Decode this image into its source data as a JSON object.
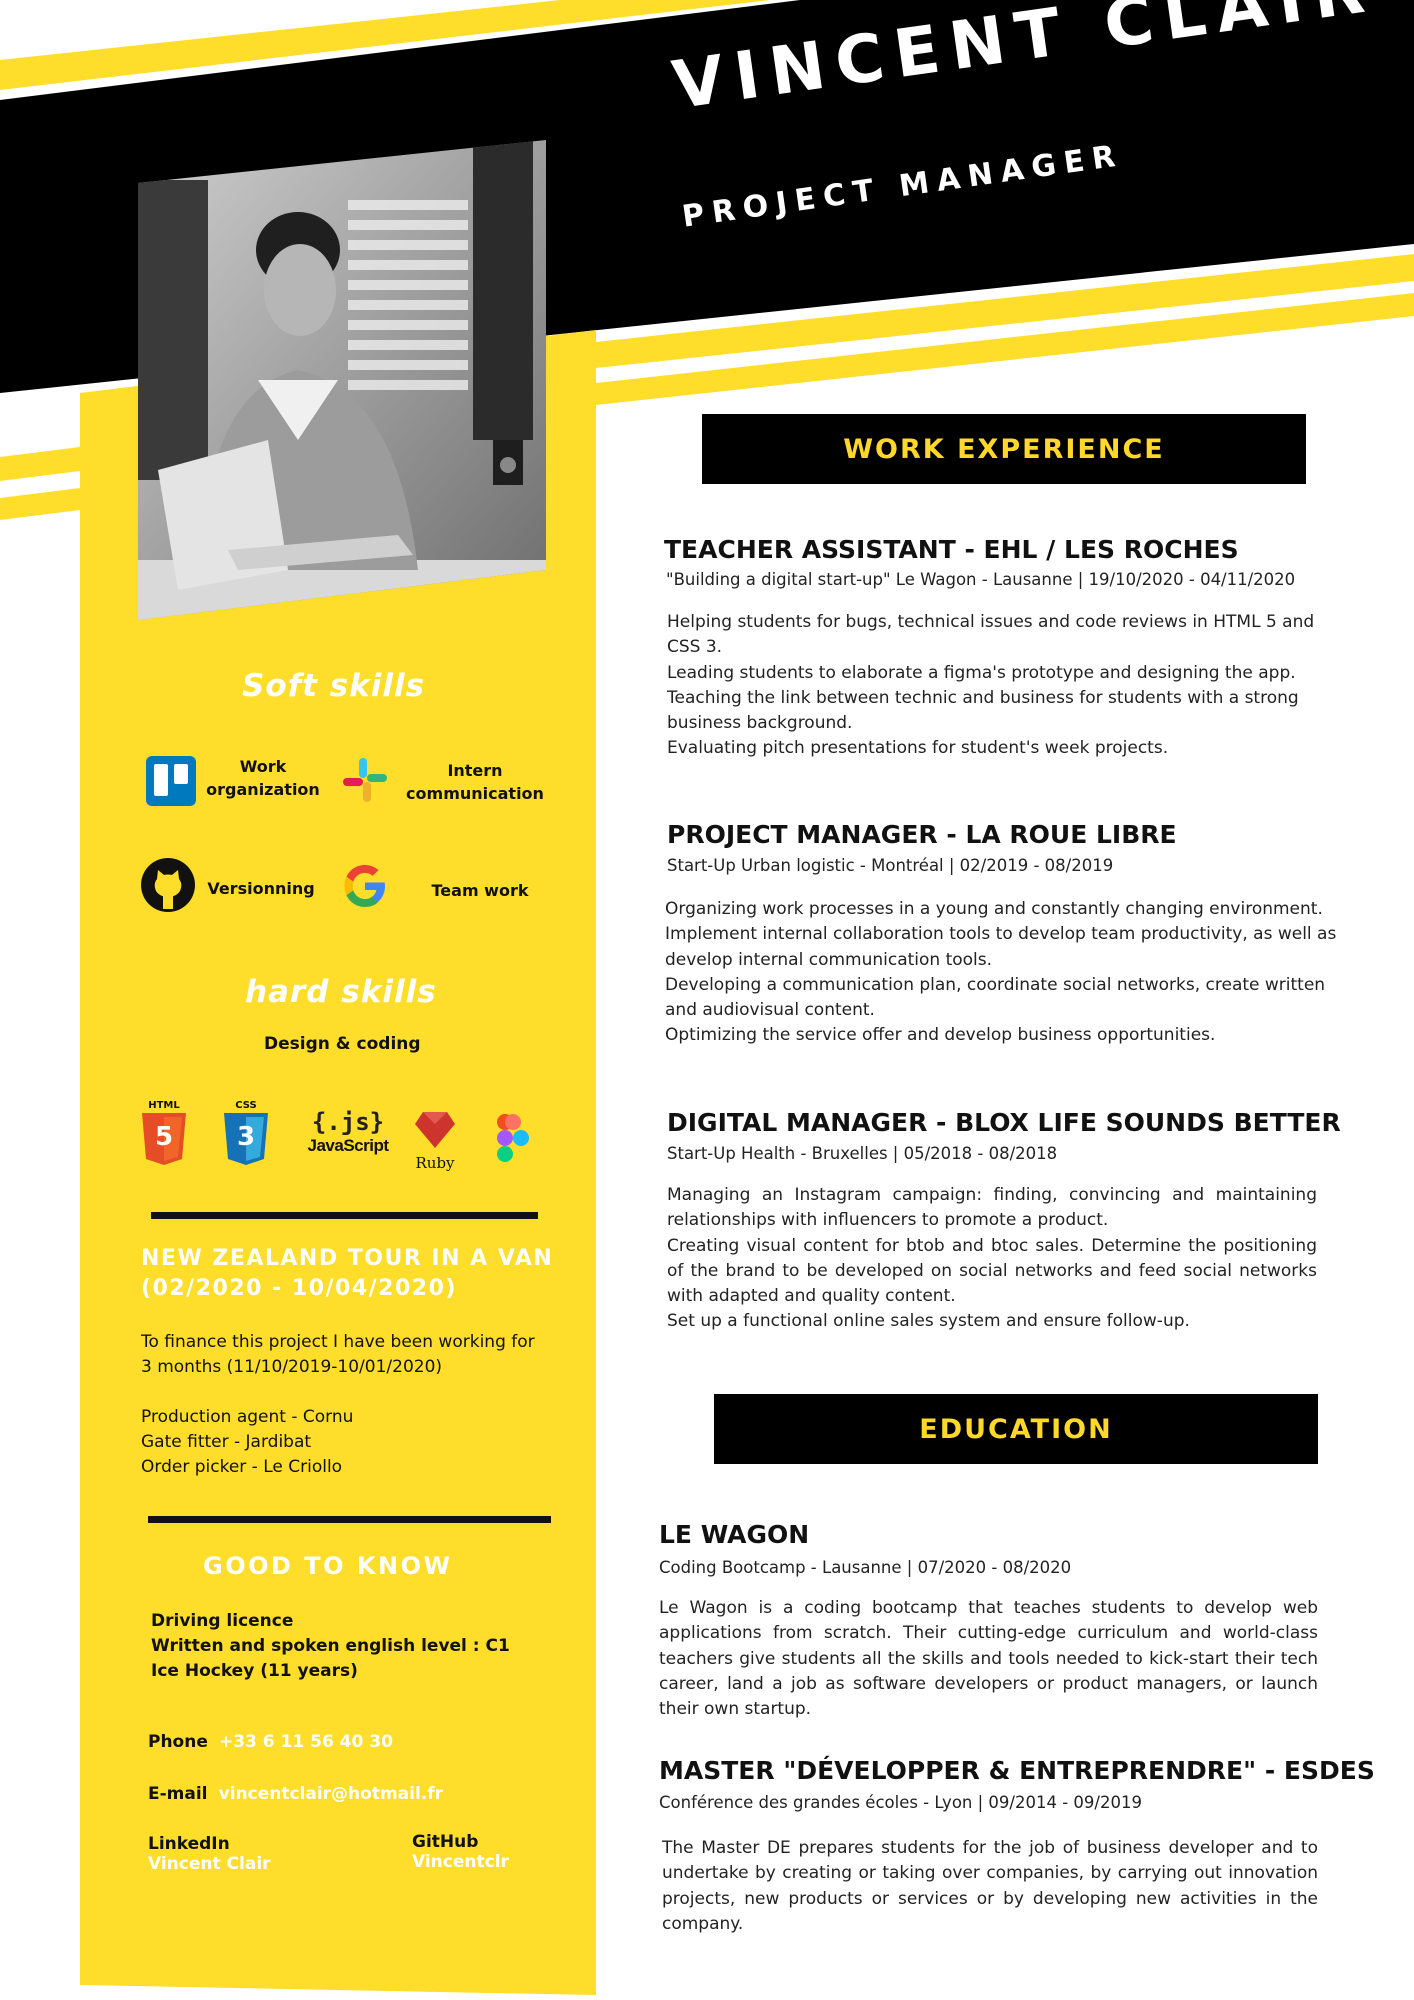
{
  "header": {
    "name": "VINCENT CLAIR",
    "role": "PROJECT MANAGER"
  },
  "soft_skills": {
    "title": "Soft skills",
    "items": [
      {
        "icon": "trello-icon",
        "label": "Work\norganization"
      },
      {
        "icon": "slack-icon",
        "label": "Intern\ncommunication"
      },
      {
        "icon": "github-icon",
        "label": "Versionning"
      },
      {
        "icon": "google-icon",
        "label": "Team work"
      }
    ]
  },
  "hard_skills": {
    "title": "hard skills",
    "subtitle": "Design & coding",
    "icons": {
      "html_label": "HTML",
      "html_glyph": "5",
      "css_label": "CSS",
      "css_glyph": "3",
      "js_glyph": "{.js}",
      "js_label": "JavaScript",
      "ruby_label": "Ruby"
    }
  },
  "tour": {
    "title_line1": "NEW ZEALAND TOUR IN A VAN",
    "title_line2": "(02/2020 - 10/04/2020)",
    "text_line1": "To finance this project I have been working for",
    "text_line2": "3 months (11/10/2019-10/01/2020)",
    "jobs": [
      "Production agent - Cornu",
      "Gate fitter - Jardibat",
      "Order picker - Le Criollo"
    ]
  },
  "good_to_know": {
    "title": "GOOD TO KNOW",
    "items": [
      "Driving licence",
      "Written and spoken english level : C1",
      "Ice Hockey (11 years)"
    ]
  },
  "contact": {
    "phone_label": "Phone",
    "phone": "+33 6 11 56 40 30",
    "email_label": "E-mail",
    "email": "vincentclair@hotmail.fr",
    "linkedin_label": "LinkedIn",
    "linkedin": "Vincent Clair",
    "github_label": "GitHub",
    "github": "Vincentclr"
  },
  "work_experience": {
    "title": "WORK EXPERIENCE",
    "jobs": [
      {
        "title": "TEACHER ASSISTANT - EHL / LES ROCHES",
        "subtitle": "\"Building a digital start-up\" Le Wagon - Lausanne | 19/10/2020 - 04/11/2020",
        "lines": [
          "Helping students for bugs, technical issues and code reviews in HTML 5 and",
          "CSS 3.",
          "Leading students to elaborate a figma's prototype and designing the app.",
          "Teaching the link between technic and business for students with a strong",
          "business background.",
          "Evaluating pitch presentations for student's week projects."
        ]
      },
      {
        "title": "PROJECT MANAGER - LA ROUE LIBRE",
        "subtitle": "Start-Up Urban logistic - Montréal | 02/2019 - 08/2019",
        "lines": [
          "Organizing work processes in a young and constantly changing environment.",
          "Implement internal collaboration tools to develop team productivity, as well as",
          "develop internal communication tools.",
          "Developing a communication plan, coordinate social networks, create written",
          "and audiovisual content.",
          "Optimizing the service offer and develop business opportunities."
        ]
      },
      {
        "title": "DIGITAL MANAGER - BLOX LIFE SOUNDS BETTER",
        "subtitle": "Start-Up Health - Bruxelles | 05/2018 - 08/2018",
        "text": "Managing an Instagram campaign: finding, convincing and maintaining relationships with influencers to promote a product.\nCreating visual content for btob and btoc sales. Determine the positioning of the brand to be developed on social networks and feed social networks with adapted and quality content.\nSet up a functional online sales system and ensure follow-up."
      }
    ]
  },
  "education": {
    "title": "EDUCATION",
    "items": [
      {
        "title": "LE WAGON",
        "subtitle": "Coding Bootcamp - Lausanne | 07/2020 - 08/2020",
        "text": "Le Wagon is a coding bootcamp that teaches students to develop web applications from scratch. Their cutting-edge curriculum and world-class teachers give students all the skills and tools needed to kick-start their tech career, land a job as software developers or product managers, or launch their own startup."
      },
      {
        "title": "MASTER \"DÉVELOPPER & ENTREPRENDRE\" - ESDES",
        "subtitle": "Conférence des grandes écoles - Lyon | 09/2014 - 09/2019",
        "text": "The Master DE prepares students for the job of business developer and to undertake by creating or taking over companies, by carrying out innovation projects, new products or services or by developing new activities in the company."
      }
    ]
  },
  "colors": {
    "yellow": "#FFDD2B",
    "black": "#000000"
  }
}
